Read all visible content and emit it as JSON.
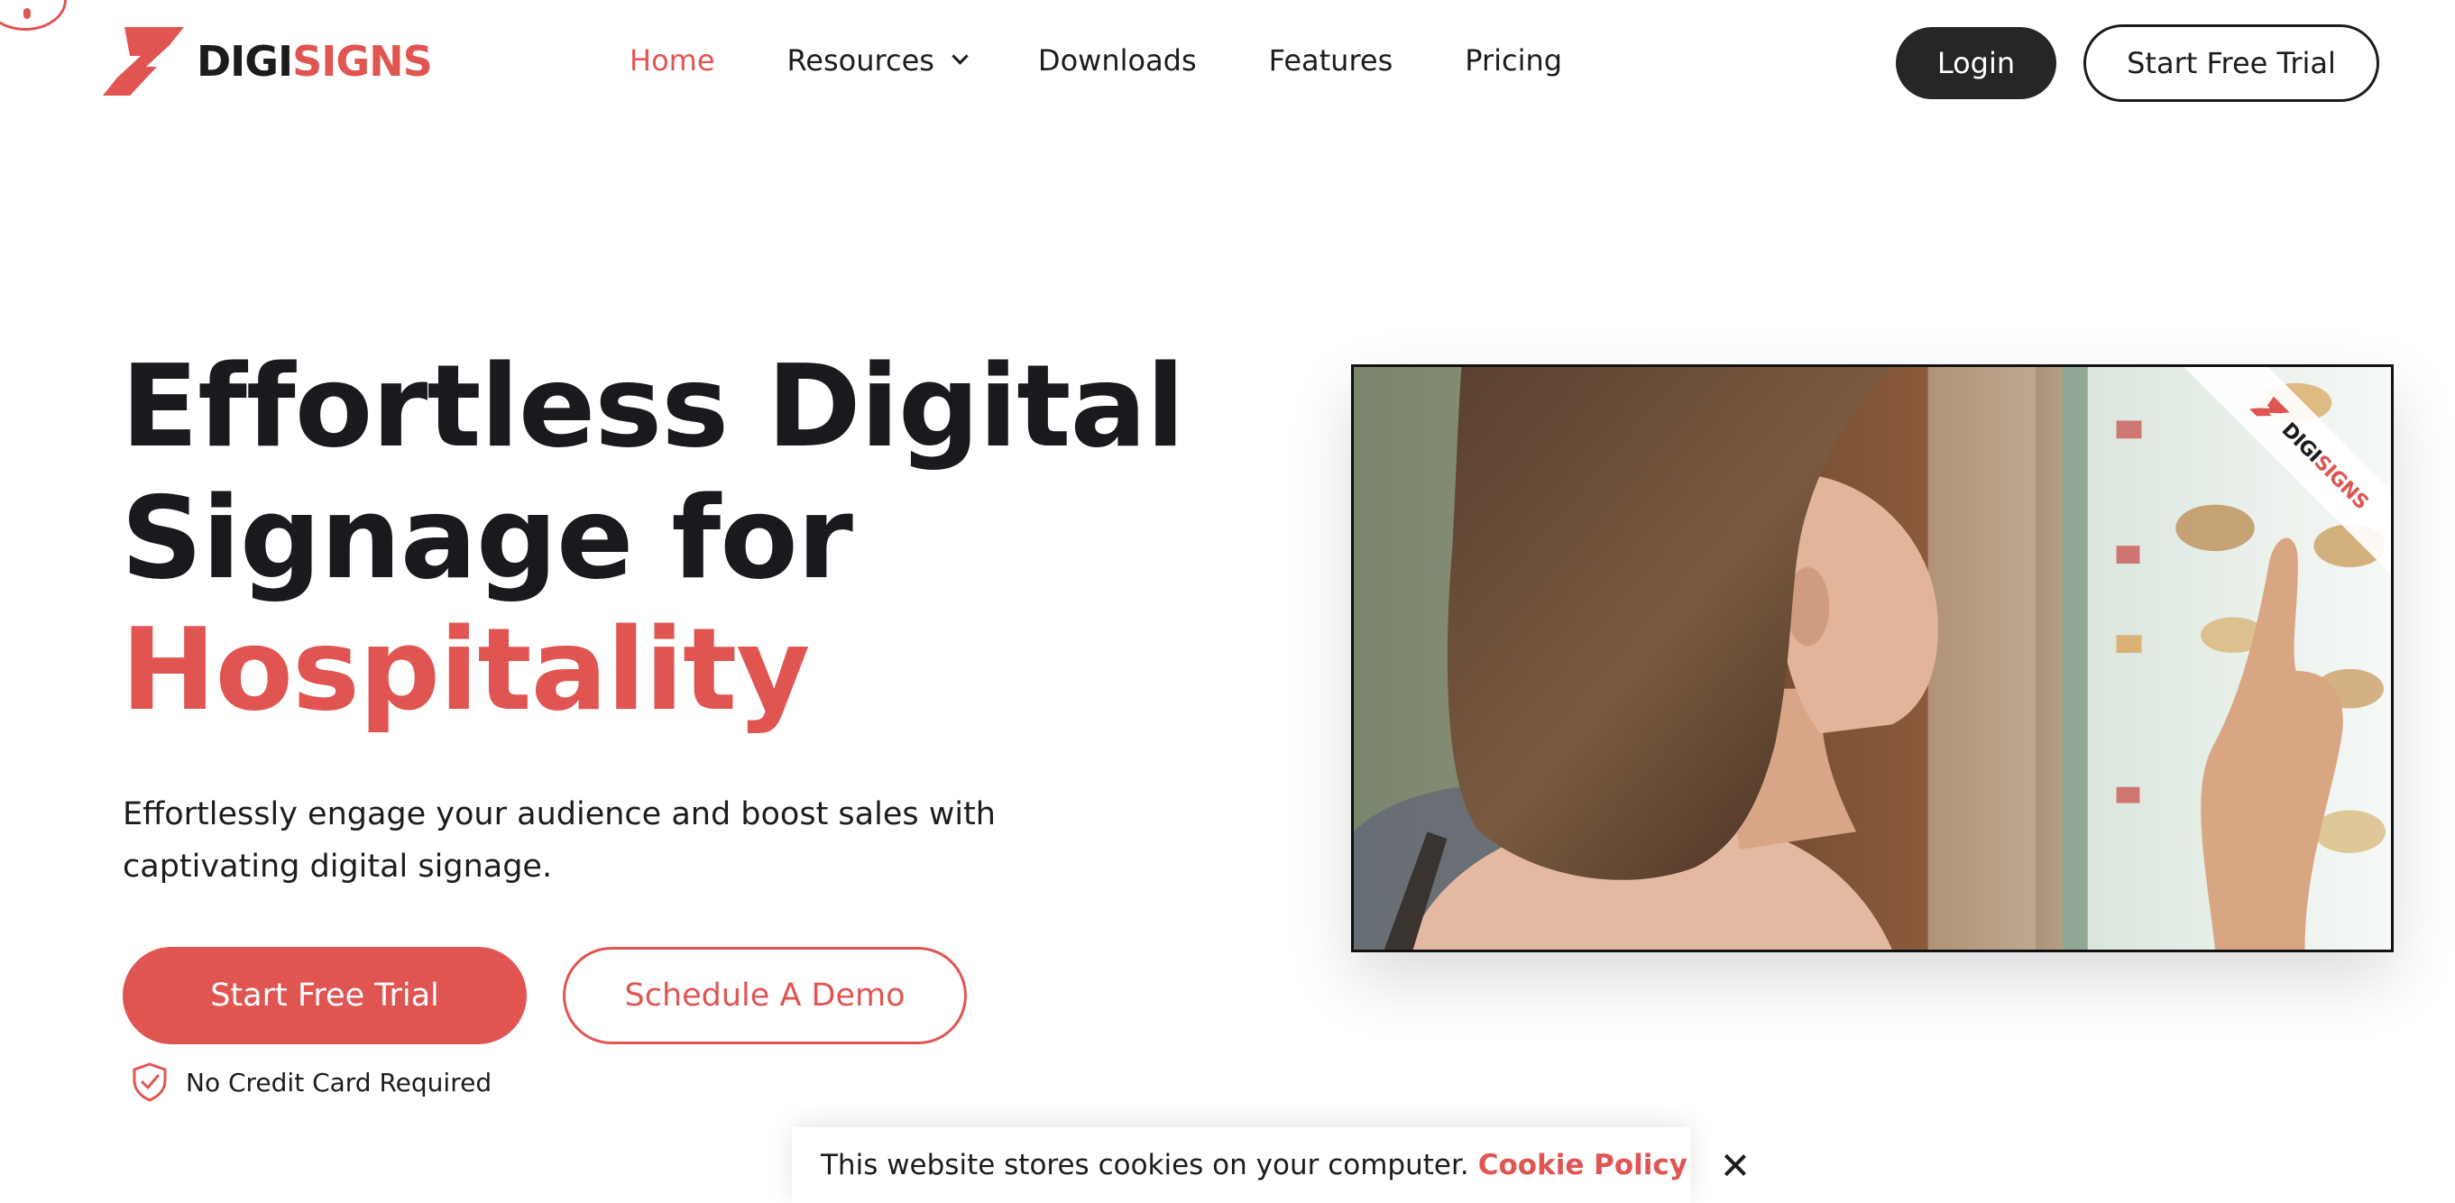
{
  "colors": {
    "brand_red": "#e05552",
    "dark": "#1c1c1e",
    "login_bg": "#262626"
  },
  "logo": {
    "part1": "DIGI",
    "part2": "SIGNS",
    "icon": "lightning-bolt-logo-icon"
  },
  "nav": {
    "items": [
      {
        "label": "Home",
        "active": true
      },
      {
        "label": "Resources",
        "has_dropdown": true
      },
      {
        "label": "Downloads"
      },
      {
        "label": "Features"
      },
      {
        "label": "Pricing"
      }
    ]
  },
  "header": {
    "login_label": "Login",
    "trial_label": "Start Free Trial"
  },
  "hero": {
    "title_line1": "Effortless Digital",
    "title_line2": "Signage for",
    "title_accent": "Hospitality",
    "subtitle": "Effortlessly engage your audience and boost sales with captivating digital signage.",
    "primary_cta": "Start Free Trial",
    "secondary_cta": "Schedule A Demo",
    "note": "No Credit Card Required",
    "note_icon": "shield-check-icon"
  },
  "video": {
    "watermark_part1": "DIGI",
    "watermark_part2": "SIGNS"
  },
  "cookie": {
    "text": "This website stores cookies on your computer.",
    "link": "Cookie Policy",
    "close_icon": "close-icon"
  }
}
